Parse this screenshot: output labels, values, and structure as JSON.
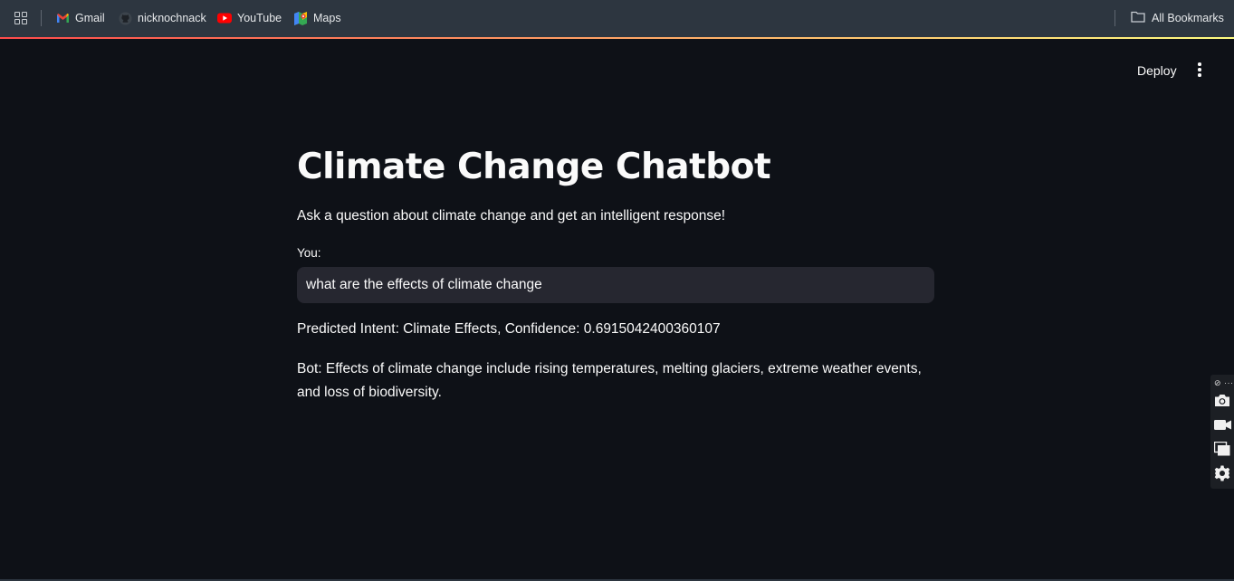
{
  "bookmarks": {
    "items": [
      {
        "label": "Gmail",
        "icon": "gmail-icon"
      },
      {
        "label": "nicknochnack",
        "icon": "github-icon"
      },
      {
        "label": "YouTube",
        "icon": "youtube-icon"
      },
      {
        "label": "Maps",
        "icon": "maps-icon"
      }
    ],
    "all_bookmarks": "All Bookmarks"
  },
  "header": {
    "deploy_label": "Deploy",
    "menu_icon": "kebab-menu-icon"
  },
  "main": {
    "title": "Climate Change Chatbot",
    "subtitle": "Ask a question about climate change and get an intelligent response!",
    "input_label": "You:",
    "input_value": "what are the effects of climate change",
    "intent_line": "Predicted Intent: Climate Effects, Confidence: 0.6915042400360107",
    "bot_response": "Bot: Effects of climate change include rising temperatures, melting glaciers, extreme weather events, and loss of biodiversity."
  },
  "side_toolbar": {
    "top_label": "⊘ ···",
    "buttons": [
      "camera-icon",
      "video-icon",
      "windows-icon",
      "gear-icon"
    ]
  },
  "colors": {
    "background": "#0e1117",
    "input_bg": "#262730",
    "bookmarks_bar": "#2d3640",
    "accent_gradient_start": "#ff4b4b",
    "accent_gradient_end": "#fffd80"
  }
}
